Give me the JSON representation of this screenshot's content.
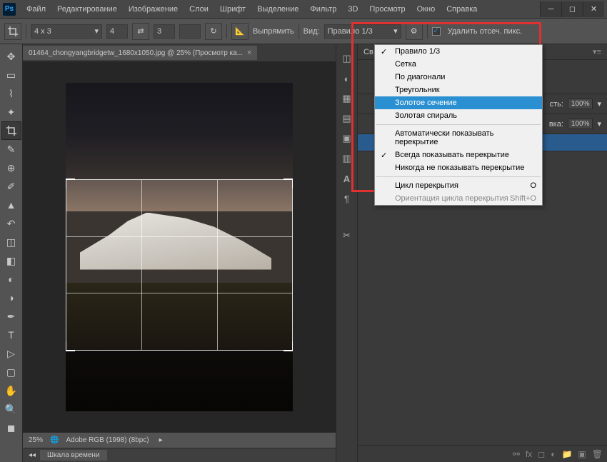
{
  "menu": [
    "Файл",
    "Редактирование",
    "Изображение",
    "Слои",
    "Шрифт",
    "Выделение",
    "Фильтр",
    "3D",
    "Просмотр",
    "Окно",
    "Справка"
  ],
  "options": {
    "ratio": "4 x 3",
    "width": "4",
    "height": "3",
    "straighten": "Выпрямить",
    "view_label": "Вид:",
    "view_value": "Правило 1/3",
    "delete_px": "Удалить отсеч. пикс."
  },
  "dropdown": {
    "group1": [
      {
        "label": "Правило 1/3",
        "checked": true
      },
      {
        "label": "Сетка"
      },
      {
        "label": "По диагонали"
      },
      {
        "label": "Треугольник"
      },
      {
        "label": "Золотое сечение",
        "highlighted": true
      },
      {
        "label": "Золотая спираль"
      }
    ],
    "group2": [
      {
        "label": "Автоматически показывать перекрытие"
      },
      {
        "label": "Всегда показывать перекрытие",
        "checked": true
      },
      {
        "label": "Никогда не показывать перекрытие"
      }
    ],
    "group3": [
      {
        "label": "Цикл перекрытия",
        "shortcut": "O"
      },
      {
        "label": "Ориентация цикла перекрытия",
        "shortcut": "Shift+O",
        "disabled": true
      }
    ]
  },
  "doc": {
    "tab": "01464_chongyangbridgetw_1680x1050.jpg @ 25% (Просмотр ка...",
    "zoom": "25%",
    "profile": "Adobe RGB (1998) (8bpc)"
  },
  "panels": {
    "header": "Св",
    "char": "A",
    "opacity_label": "сть:",
    "opacity_value": "100%",
    "fill_label": "вка:",
    "fill_value": "100%"
  },
  "timeline": "Шкала времени"
}
